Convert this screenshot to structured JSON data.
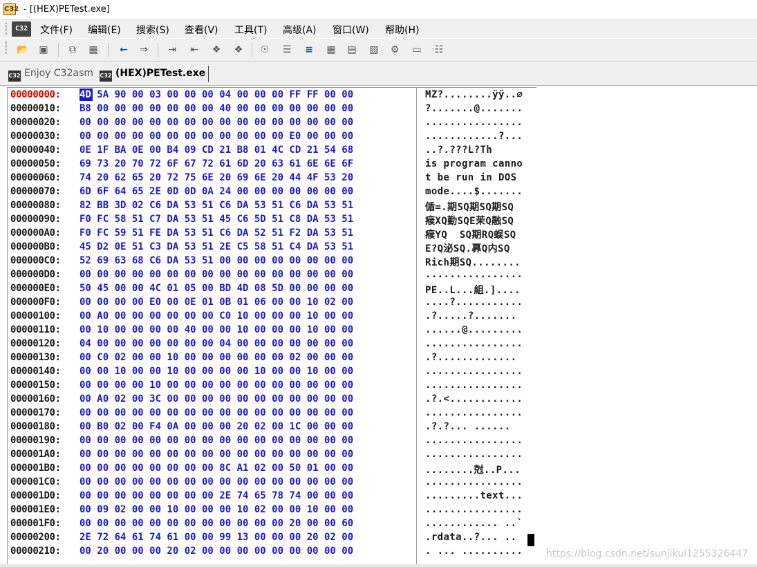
{
  "window": {
    "title": " - [(HEX)PETest.exe]",
    "app_icon": "C32"
  },
  "menu": {
    "icon": "C32",
    "items": [
      "文件(F)",
      "编辑(E)",
      "搜索(S)",
      "查看(V)",
      "工具(T)",
      "高级(A)",
      "窗口(W)",
      "帮助(H)"
    ]
  },
  "toolbar": {
    "icons": [
      "open-folder-icon",
      "save-icon",
      "copy-icon",
      "properties-icon",
      "back-arrow-icon",
      "forward-arrow-icon",
      "indent-icon",
      "outdent-icon",
      "bookmark-icon",
      "bookmark-next-icon",
      "refresh-icon",
      "list-icon",
      "align-icon",
      "grid-icon",
      "grid-small-icon",
      "grid-dotted-icon",
      "settings-icon",
      "window-icon",
      "table-icon"
    ]
  },
  "tabs": [
    {
      "label": "Enjoy C32asm",
      "active": false
    },
    {
      "label": "(HEX)PETest.exe",
      "active": true
    }
  ],
  "hex": {
    "rows": [
      {
        "addr": "00000000:",
        "bytes": "4D 5A 90 00 03 00 00 00 04 00 00 00 FF FF 00 00",
        "ascii": "MZ?........ÿÿ..∅"
      },
      {
        "addr": "00000010:",
        "bytes": "B8 00 00 00 00 00 00 00 40 00 00 00 00 00 00 00",
        "ascii": "?.......@......."
      },
      {
        "addr": "00000020:",
        "bytes": "00 00 00 00 00 00 00 00 00 00 00 00 00 00 00 00",
        "ascii": "................"
      },
      {
        "addr": "00000030:",
        "bytes": "00 00 00 00 00 00 00 00 00 00 00 00 E0 00 00 00",
        "ascii": "............?..."
      },
      {
        "addr": "00000040:",
        "bytes": "0E 1F BA 0E 00 B4 09 CD 21 B8 01 4C CD 21 54 68",
        "ascii": "..?.???L?Th"
      },
      {
        "addr": "00000050:",
        "bytes": "69 73 20 70 72 6F 67 72 61 6D 20 63 61 6E 6E 6F",
        "ascii": "is program canno"
      },
      {
        "addr": "00000060:",
        "bytes": "74 20 62 65 20 72 75 6E 20 69 6E 20 44 4F 53 20",
        "ascii": "t be run in DOS "
      },
      {
        "addr": "00000070:",
        "bytes": "6D 6F 64 65 2E 0D 0D 0A 24 00 00 00 00 00 00 00",
        "ascii": "mode....$......."
      },
      {
        "addr": "00000080:",
        "bytes": "82 BB 3D 02 C6 DA 53 51 C6 DA 53 51 C6 DA 53 51",
        "ascii": "偱=.期SQ期SQ期SQ"
      },
      {
        "addr": "00000090:",
        "bytes": "F0 FC 58 51 C7 DA 53 51 45 C6 5D 51 C8 DA 53 51",
        "ascii": "瘊XQ勤SQE茉Q融SQ"
      },
      {
        "addr": "000000A0:",
        "bytes": "F0 FC 59 51 FE DA 53 51 C6 DA 52 51 F2 DA 53 51",
        "ascii": "瘊YQ  SQ期RQ蜈SQ"
      },
      {
        "addr": "000000B0:",
        "bytes": "45 D2 0E 51 C3 DA 53 51 2E C5 58 51 C4 DA 53 51",
        "ascii": "E?Q泌SQ.奡Q内SQ"
      },
      {
        "addr": "000000C0:",
        "bytes": "52 69 63 68 C6 DA 53 51 00 00 00 00 00 00 00 00",
        "ascii": "Rich期SQ........"
      },
      {
        "addr": "000000D0:",
        "bytes": "00 00 00 00 00 00 00 00 00 00 00 00 00 00 00 00",
        "ascii": "................"
      },
      {
        "addr": "000000E0:",
        "bytes": "50 45 00 00 4C 01 05 00 BD 4D 08 5D 00 00 00 00",
        "ascii": "PE..L...組.]...."
      },
      {
        "addr": "000000F0:",
        "bytes": "00 00 00 00 E0 00 0E 01 0B 01 06 00 00 10 02 00",
        "ascii": "....?..........."
      },
      {
        "addr": "00000100:",
        "bytes": "00 A0 00 00 00 00 00 00 C0 10 00 00 00 10 00 00",
        "ascii": ".?.....?......."
      },
      {
        "addr": "00000110:",
        "bytes": "00 10 00 00 00 00 40 00 00 10 00 00 00 10 00 00",
        "ascii": "......@........."
      },
      {
        "addr": "00000120:",
        "bytes": "04 00 00 00 00 00 00 00 04 00 00 00 00 00 00 00",
        "ascii": "................"
      },
      {
        "addr": "00000130:",
        "bytes": "00 C0 02 00 00 10 00 00 00 00 00 00 02 00 00 00",
        "ascii": ".?............."
      },
      {
        "addr": "00000140:",
        "bytes": "00 00 10 00 00 10 00 00 00 00 10 00 00 10 00 00",
        "ascii": "................"
      },
      {
        "addr": "00000150:",
        "bytes": "00 00 00 00 10 00 00 00 00 00 00 00 00 00 00 00",
        "ascii": "................"
      },
      {
        "addr": "00000160:",
        "bytes": "00 A0 02 00 3C 00 00 00 00 00 00 00 00 00 00 00",
        "ascii": ".?.<............"
      },
      {
        "addr": "00000170:",
        "bytes": "00 00 00 00 00 00 00 00 00 00 00 00 00 00 00 00",
        "ascii": "................"
      },
      {
        "addr": "00000180:",
        "bytes": "00 B0 02 00 F4 0A 00 00 00 20 02 00 1C 00 00 00",
        "ascii": ".?.?... ......"
      },
      {
        "addr": "00000190:",
        "bytes": "00 00 00 00 00 00 00 00 00 00 00 00 00 00 00 00",
        "ascii": "................"
      },
      {
        "addr": "000001A0:",
        "bytes": "00 00 00 00 00 00 00 00 00 00 00 00 00 00 00 00",
        "ascii": "................"
      },
      {
        "addr": "000001B0:",
        "bytes": "00 00 00 00 00 00 00 00 8C A1 02 00 50 01 00 00",
        "ascii": "........尅..P..."
      },
      {
        "addr": "000001C0:",
        "bytes": "00 00 00 00 00 00 00 00 00 00 00 00 00 00 00 00",
        "ascii": "................"
      },
      {
        "addr": "000001D0:",
        "bytes": "00 00 00 00 00 00 00 00 2E 74 65 78 74 00 00 00",
        "ascii": ".........text..."
      },
      {
        "addr": "000001E0:",
        "bytes": "00 09 02 00 00 10 00 00 00 10 02 00 00 10 00 00",
        "ascii": "................"
      },
      {
        "addr": "000001F0:",
        "bytes": "00 00 00 00 00 00 00 00 00 00 00 00 20 00 00 60",
        "ascii": "............ ..`"
      },
      {
        "addr": "00000200:",
        "bytes": "2E 72 64 61 74 61 00 00 99 13 00 00 00 20 02 00",
        "ascii": ".rdata..?... .."
      },
      {
        "addr": "00000210:",
        "bytes": "00 20 00 00 00 20 02 00 00 00 00 00 00 00 00 00",
        "ascii": ". ... .........."
      }
    ]
  },
  "watermark": "https://blog.csdn.net/sunjikui1255326447",
  "colors": {
    "address": "#1a1a1a",
    "address_current": "#e00000",
    "hex_bytes": "#1a1acc",
    "selection": "#1a1acc"
  }
}
